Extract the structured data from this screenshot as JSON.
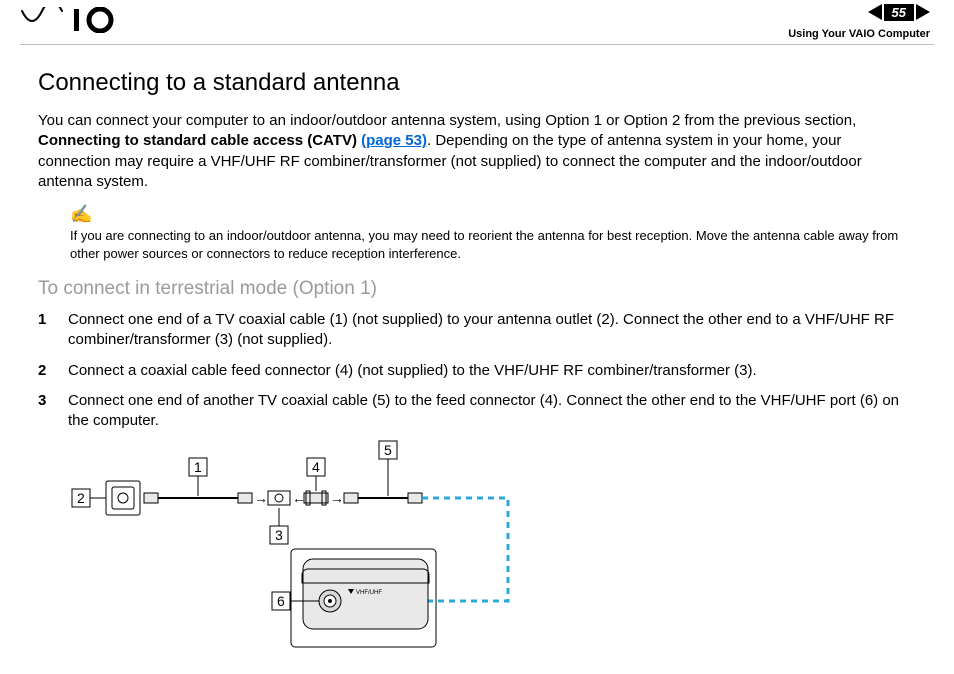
{
  "header": {
    "page_number": "55",
    "section": "Using Your VAIO Computer"
  },
  "title": "Connecting to a standard antenna",
  "intro_parts": {
    "pre": "You can connect your computer to an indoor/outdoor antenna system, using Option 1 or Option 2 from the previous section, ",
    "bold": "Connecting to standard cable access (CATV) ",
    "link": "(page 53)",
    "post": ". Depending on the type of antenna system in your home, your connection may require a VHF/UHF RF combiner/transformer (not supplied) to connect the computer and the indoor/outdoor antenna system."
  },
  "note_icon": "✍",
  "note": "If you are connecting to an indoor/outdoor antenna, you may need to reorient the antenna for best reception. Move the antenna cable away from other power sources or connectors to reduce reception interference.",
  "subtitle": "To connect in terrestrial mode (Option 1)",
  "steps": [
    "Connect one end of a TV coaxial cable (1) (not supplied) to your antenna outlet (2). Connect the other end to a VHF/UHF RF combiner/transformer (3) (not supplied).",
    "Connect a coaxial cable feed connector (4) (not supplied) to the VHF/UHF RF combiner/transformer (3).",
    "Connect one end of another TV coaxial cable (5) to the feed connector (4). Connect the other end to the VHF/UHF port (6) on the computer."
  ],
  "diagram_labels": {
    "l1": "1",
    "l2": "2",
    "l3": "3",
    "l4": "4",
    "l5": "5",
    "l6": "6"
  }
}
